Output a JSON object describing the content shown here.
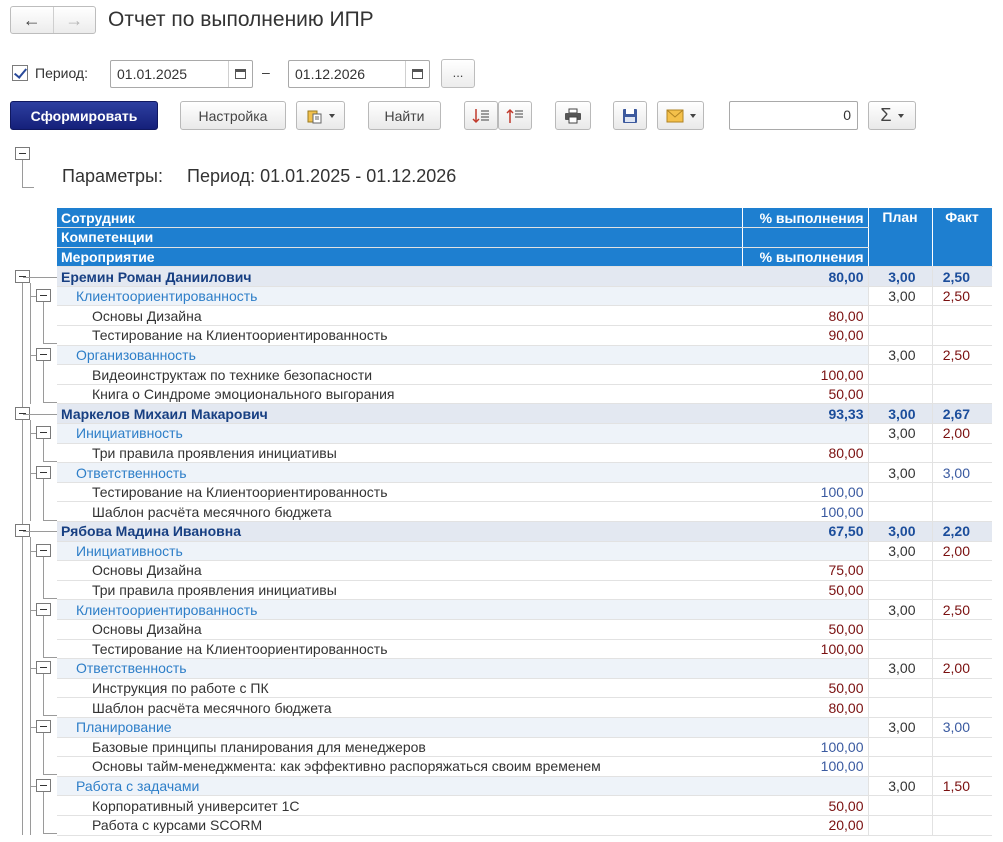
{
  "window": {
    "title": "Отчет по выполнению ИПР",
    "back_icon": "←",
    "forward_icon": "→"
  },
  "period": {
    "label": "Период:",
    "from": "01.01.2025",
    "to": "01.12.2026",
    "separator": "–",
    "choose_label": "..."
  },
  "toolbar": {
    "generate_label": "Сформировать",
    "settings_label": "Настройка",
    "find_label": "Найти",
    "counter_value": "0",
    "sum_label": "Σ"
  },
  "report": {
    "params_label": "Параметры:",
    "params_value": "Период: 01.01.2025 - 01.12.2026",
    "headers": {
      "employee": "Сотрудник",
      "competence": "Компетенции",
      "event": "Мероприятие",
      "pct_top": "% выполнения",
      "pct_bottom": "% выполнения",
      "plan": "План",
      "fact": "Факт"
    },
    "employees": [
      {
        "name": "Еремин Роман Даниилович",
        "pct": "80,00",
        "plan": "3,00",
        "fact": "2,50",
        "competences": [
          {
            "name": "Клиентоориентированность",
            "plan": "3,00",
            "fact": "2,50",
            "fact_color": "red",
            "events": [
              {
                "name": "Основы Дизайна",
                "pct": "80,00",
                "color": "red"
              },
              {
                "name": "Тестирование на Клиентоориентированность",
                "pct": "90,00",
                "color": "red"
              }
            ]
          },
          {
            "name": "Организованность",
            "plan": "3,00",
            "fact": "2,50",
            "fact_color": "red",
            "events": [
              {
                "name": "Видеоинструктаж по технике безопасности",
                "pct": "100,00",
                "color": "red"
              },
              {
                "name": "Книга о Синдроме эмоционального выгорания",
                "pct": "50,00",
                "color": "red"
              }
            ]
          }
        ]
      },
      {
        "name": "Маркелов Михаил Макарович",
        "pct": "93,33",
        "plan": "3,00",
        "fact": "2,67",
        "competences": [
          {
            "name": "Инициативность",
            "plan": "3,00",
            "fact": "2,00",
            "fact_color": "red",
            "events": [
              {
                "name": "Три правила проявления инициативы",
                "pct": "80,00",
                "color": "red"
              }
            ]
          },
          {
            "name": "Ответственность",
            "plan": "3,00",
            "fact": "3,00",
            "fact_color": "blue",
            "events": [
              {
                "name": "Тестирование на Клиентоориентированность",
                "pct": "100,00",
                "color": "blue"
              },
              {
                "name": "Шаблон расчёта месячного бюджета",
                "pct": "100,00",
                "color": "blue"
              }
            ]
          }
        ]
      },
      {
        "name": "Рябова Мадина Ивановна",
        "pct": "67,50",
        "plan": "3,00",
        "fact": "2,20",
        "competences": [
          {
            "name": "Инициативность",
            "plan": "3,00",
            "fact": "2,00",
            "fact_color": "red",
            "events": [
              {
                "name": "Основы Дизайна",
                "pct": "75,00",
                "color": "red"
              },
              {
                "name": "Три правила проявления инициативы",
                "pct": "50,00",
                "color": "red"
              }
            ]
          },
          {
            "name": "Клиентоориентированность",
            "plan": "3,00",
            "fact": "2,50",
            "fact_color": "red",
            "events": [
              {
                "name": "Основы Дизайна",
                "pct": "50,00",
                "color": "red"
              },
              {
                "name": "Тестирование на Клиентоориентированность",
                "pct": "100,00",
                "color": "red"
              }
            ]
          },
          {
            "name": "Ответственность",
            "plan": "3,00",
            "fact": "2,00",
            "fact_color": "red",
            "events": [
              {
                "name": "Инструкция по работе с ПК",
                "pct": "50,00",
                "color": "red"
              },
              {
                "name": "Шаблон расчёта месячного бюджета",
                "pct": "80,00",
                "color": "red"
              }
            ]
          },
          {
            "name": "Планирование",
            "plan": "3,00",
            "fact": "3,00",
            "fact_color": "blue",
            "events": [
              {
                "name": "Базовые принципы планирования для менеджеров",
                "pct": "100,00",
                "color": "blue"
              },
              {
                "name": "Основы тайм-менеджмента: как эффективно распоряжаться своим временем",
                "pct": "100,00",
                "color": "blue"
              }
            ]
          },
          {
            "name": "Работа с задачами",
            "plan": "3,00",
            "fact": "1,50",
            "fact_color": "red",
            "events": [
              {
                "name": "Корпоративный университет 1С",
                "pct": "50,00",
                "color": "red"
              },
              {
                "name": "Работа с курсами SCORM",
                "pct": "20,00",
                "color": "red"
              }
            ]
          }
        ]
      }
    ]
  }
}
